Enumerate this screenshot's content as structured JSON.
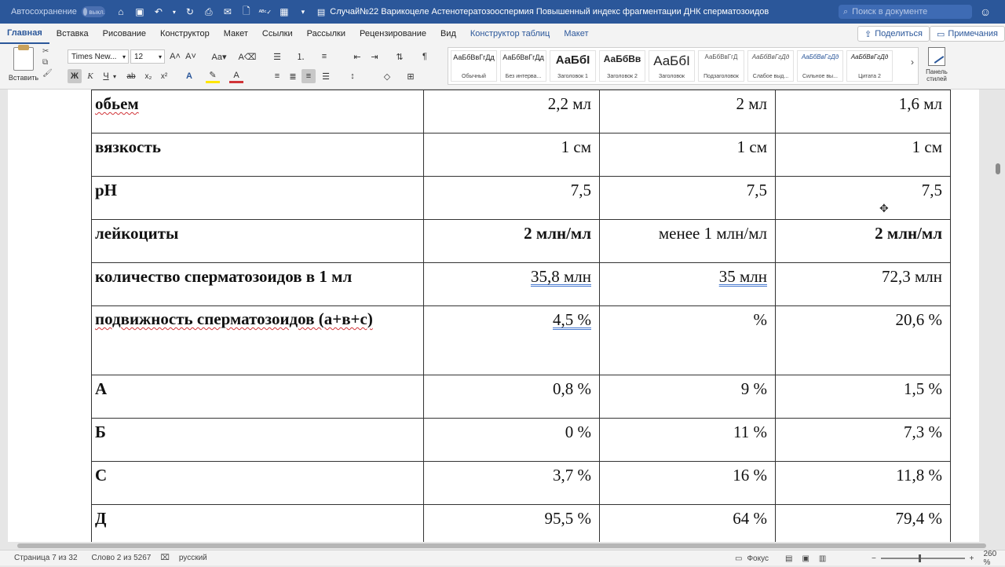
{
  "titlebar": {
    "autosave_label": "Автосохранение",
    "autosave_state": "выкл.",
    "document_title": "Случай№22 Варикоцеле Астенотератозооспермия Повышенный индекс фрагментации ДНК сперматозоидов",
    "search_placeholder": "Поиск в документе"
  },
  "tabs": [
    "Главная",
    "Вставка",
    "Рисование",
    "Конструктор",
    "Макет",
    "Ссылки",
    "Рассылки",
    "Рецензирование",
    "Вид",
    "Конструктор таблиц",
    "Макет"
  ],
  "active_tab_index": 0,
  "actions": {
    "share": "Поделиться",
    "comments": "Примечания"
  },
  "ribbon": {
    "paste_label": "Вставить",
    "font_name": "Times New...",
    "font_size": "12",
    "styles": [
      {
        "sample": "АаБбВвГгДд",
        "name": "Обычный"
      },
      {
        "sample": "АаБбВвГгДд",
        "name": "Без интерва..."
      },
      {
        "sample": "АаБбІ",
        "name": "Заголовок 1"
      },
      {
        "sample": "АаБбВв",
        "name": "Заголовок 2"
      },
      {
        "sample": "АаБбІ",
        "name": "Заголовок"
      },
      {
        "sample": "АаБбВвГгД",
        "name": "Подзаголовок"
      },
      {
        "sample": "АаБбВвГгДд",
        "name": "Слабое выд..."
      },
      {
        "sample": "АаБбВвГгДд",
        "name": "Сильное вы..."
      },
      {
        "sample": "АаБбВвГгДд",
        "name": "Цитата 2"
      }
    ],
    "styles_pane_label": "Панель стилей"
  },
  "table": {
    "rows": [
      {
        "name": "обьем",
        "v1": "2,2 мл",
        "v2": "2 мл",
        "v3": "1,6 мл"
      },
      {
        "name": "вязкость",
        "v1": "1 см",
        "v2": "1 см",
        "v3": "1 см"
      },
      {
        "name": "pH",
        "v1": "7,5",
        "v2": "7,5",
        "v3": "7,5"
      },
      {
        "name": "лейкоциты",
        "v1": "2 млн/мл",
        "v2": "менее 1 млн/мл",
        "v3": "2 млн/мл"
      },
      {
        "name": "количество сперматозоидов в 1 мл",
        "v1": "35,8  млн",
        "v2": "35  млн",
        "v3": "72,3 млн"
      },
      {
        "name": "подвижность сперматозоидов (а+в+с)",
        "v1": "4,5  %",
        "v2": "%",
        "v3": "20,6 %"
      },
      {
        "name": "А",
        "v1": "0,8 %",
        "v2": "9 %",
        "v3": "1,5 %"
      },
      {
        "name": "Б",
        "v1": "0 %",
        "v2": "11 %",
        "v3": "7,3 %"
      },
      {
        "name": "С",
        "v1": "3,7 %",
        "v2": "16 %",
        "v3": "11,8 %"
      },
      {
        "name": "Д",
        "v1": "95,5 %",
        "v2": "64 %",
        "v3": "79,4 %"
      }
    ]
  },
  "status": {
    "page": "Страница 7 из 32",
    "words": "Слово 2 из 5267",
    "language": "русский",
    "focus": "Фокус",
    "zoom_minus": "−",
    "zoom_plus": "+",
    "zoom": "260 %"
  },
  "colors": {
    "word_blue": "#2b579a",
    "spell_red": "#d13438",
    "grammar_blue": "#4a7bd0"
  }
}
